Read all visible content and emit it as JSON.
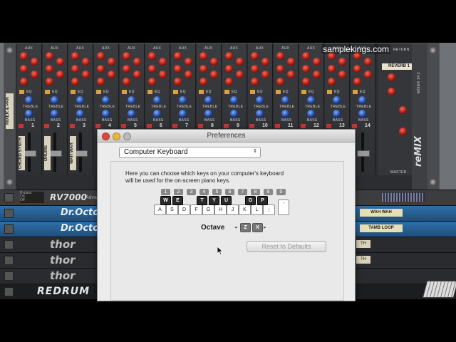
{
  "watermark": "samplekings.com",
  "mixer": {
    "channel_labels": [
      "AUX",
      "AUX",
      "AUX",
      "AUX",
      "AUX",
      "AUX",
      "AUX",
      "AUX",
      "AUX",
      "AUX",
      "AUX",
      "AUX",
      "AUX",
      "AUX"
    ],
    "eq": "EQ",
    "treble": "TREBLE",
    "bass": "BASS",
    "channel_numbers": [
      "1",
      "2",
      "3",
      "4",
      "5",
      "6",
      "7",
      "8",
      "9",
      "10",
      "11",
      "12",
      "13",
      "14"
    ],
    "return_header": "RETURN",
    "return_label": "REVERB 1",
    "master_label": "MASTER",
    "brand": "reMIX",
    "brand_sub": "MIXER 14:2",
    "side_label": "MIXER & PAN",
    "track_labels": [
      "CHORD SYNTH",
      "DRUMS",
      "WAH WAH"
    ]
  },
  "rack": {
    "rv7000": {
      "name": "RV7000",
      "sub": "Advanced",
      "bypass": "Bypass",
      "on": "On",
      "off": "Off"
    },
    "droctor": "Dr.Octo",
    "thor": "thor",
    "redrum": "REDRUM",
    "patch_labels": [
      "WAH WAH",
      "TAMB LOOP"
    ],
    "side_tags": [
      "TH",
      "TH"
    ]
  },
  "dialog": {
    "title": "Preferences",
    "dropdown": "Computer Keyboard",
    "desc_line1": "Here you can choose which keys on your computer's keyboard",
    "desc_line2": "will be used for the on-screen piano keys.",
    "number_keys": [
      "1",
      "2",
      "3",
      "4",
      "5",
      "6",
      "7",
      "8",
      "9",
      "0"
    ],
    "black_keys": [
      "W",
      "E",
      "T",
      "Y",
      "U",
      "O",
      "P"
    ],
    "white_keys": [
      "A",
      "S",
      "D",
      "F",
      "G",
      "H",
      "J",
      "K",
      "L",
      ";",
      "'"
    ],
    "octave_label": "Octave",
    "octave_down_key": "Z",
    "octave_up_key": "X",
    "reset_button": "Reset to Defaults"
  }
}
